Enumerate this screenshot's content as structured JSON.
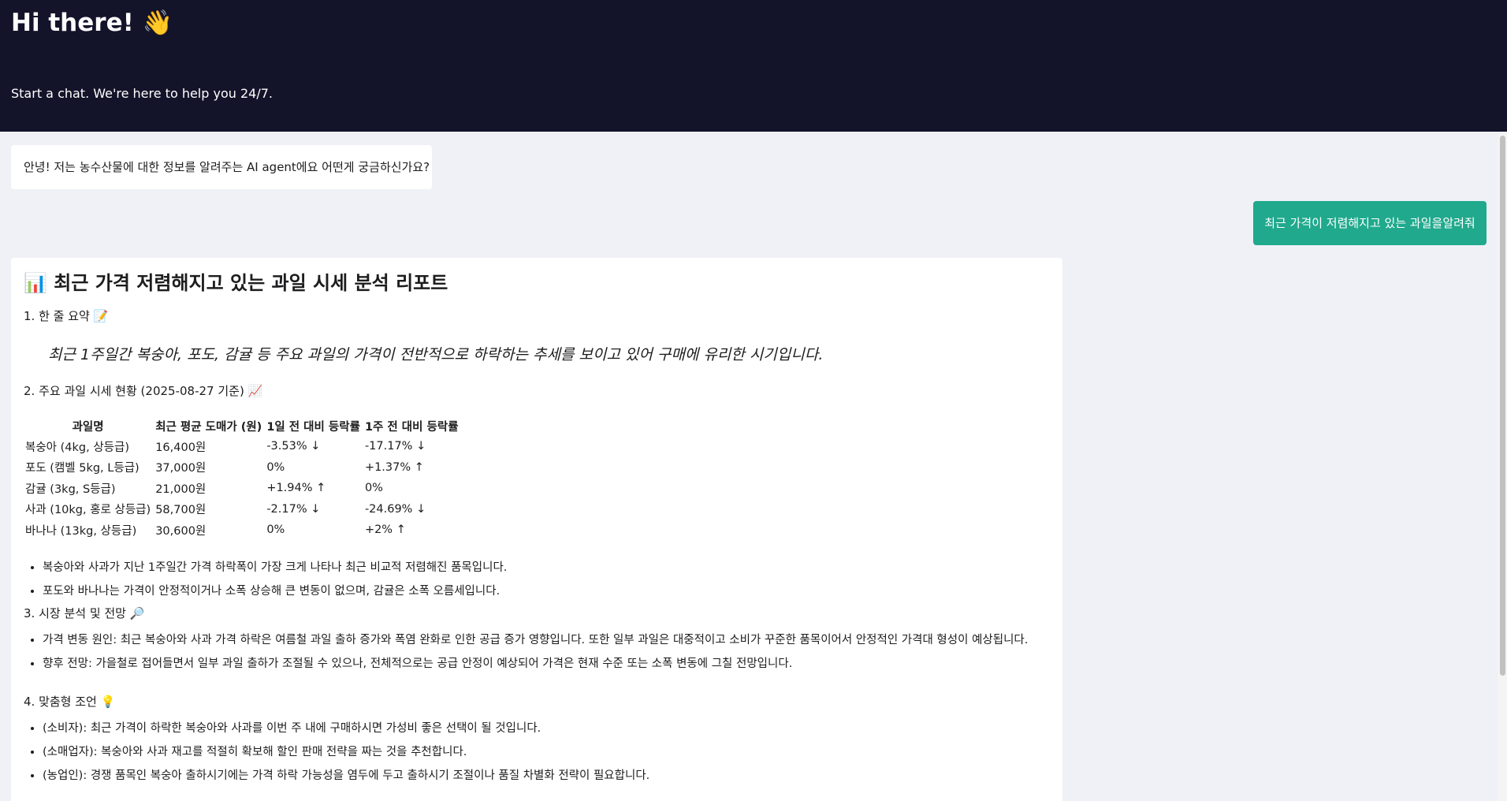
{
  "header": {
    "title": "Hi there! 👋",
    "subtitle": "Start a chat. We're here to help you 24/7."
  },
  "messages": {
    "bot_greeting": "안녕! 저는 농수산물에 대한 정보를 알려주는 AI agent에요 어떤게 궁금하신가요?",
    "user_question": "최근 가격이 저렴해지고 있는 과일을알려줘"
  },
  "report": {
    "title": "📊 최근 가격 저렴해지고 있는 과일 시세 분석 리포트",
    "section1_title": "1. 한 줄 요약 📝",
    "summary": "최근 1주일간 복숭아, 포도, 감귤 등 주요 과일의 가격이 전반적으로 하락하는 추세를 보이고 있어 구매에 유리한 시기입니다.",
    "section2_title": "2. 주요 과일 시세 현황 (2025-08-27 기준) 📈",
    "table": {
      "headers": [
        "과일명",
        "최근 평균 도매가 (원)",
        "1일 전 대비 등락률",
        "1주 전 대비 등락률"
      ],
      "rows": [
        [
          "복숭아 (4kg, 상등급)",
          "16,400원",
          "-3.53% ↓",
          "-17.17% ↓"
        ],
        [
          "포도 (캠벨 5kg, L등급)",
          "37,000원",
          "0%",
          "+1.37% ↑"
        ],
        [
          "감귤 (3kg, S등급)",
          "21,000원",
          "+1.94% ↑",
          "0%"
        ],
        [
          "사과 (10kg, 홍로 상등급)",
          "58,700원",
          "-2.17% ↓",
          "-24.69% ↓"
        ],
        [
          "바나나 (13kg, 상등급)",
          "30,600원",
          "0%",
          "+2% ↑"
        ]
      ]
    },
    "section2_bullets": [
      "복숭아와 사과가 지난 1주일간 가격 하락폭이 가장 크게 나타나 최근 비교적 저렴해진 품목입니다.",
      "포도와 바나나는 가격이 안정적이거나 소폭 상승해 큰 변동이 없으며, 감귤은 소폭 오름세입니다."
    ],
    "section3_title": "3. 시장 분석 및 전망 🔎",
    "section3_bullets": [
      "가격 변동 원인: 최근 복숭아와 사과 가격 하락은 여름철 과일 출하 증가와 폭염 완화로 인한 공급 증가 영향입니다. 또한 일부 과일은 대중적이고 소비가 꾸준한 품목이어서 안정적인 가격대 형성이 예상됩니다.",
      "향후 전망: 가을철로 접어들면서 일부 과일 출하가 조절될 수 있으나, 전체적으로는 공급 안정이 예상되어 가격은 현재 수준 또는 소폭 변동에 그칠 전망입니다."
    ],
    "section4_title": "4. 맞춤형 조언 💡",
    "section4_bullets": [
      "(소비자): 최근 가격이 하락한 복숭아와 사과를 이번 주 내에 구매하시면 가성비 좋은 선택이 될 것입니다.",
      "(소매업자): 복숭아와 사과 재고를 적절히 확보해 할인 판매 전략을 짜는 것을 추천합니다.",
      "(농업인): 경쟁 품목인 복숭아 출하시기에는 가격 하락 가능성을 염두에 두고 출하시기 조절이나 품질 차별화 전략이 필요합니다."
    ]
  },
  "colors": {
    "header_bg": "#13142a",
    "chat_bg": "#f0f1f6",
    "user_bubble": "#20a98d"
  }
}
